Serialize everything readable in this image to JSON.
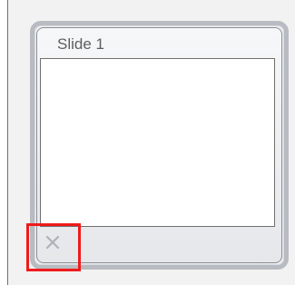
{
  "slide_panel": {
    "title": "Slide 1",
    "delete_icon": "close-icon",
    "highlight_color": "#ef1b1b"
  }
}
